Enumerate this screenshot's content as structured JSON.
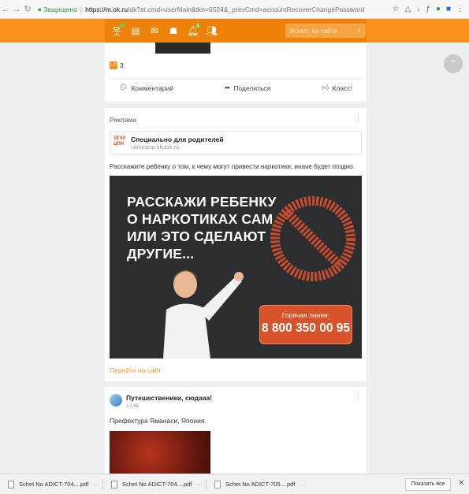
{
  "browser": {
    "secure_label": "Защищено",
    "url_host": "https://m.ok.ru",
    "url_rest": "/dk?st.cmd=userMain&tkn=6524&_prevCmd=accountRecoverChangePassword"
  },
  "header": {
    "icons": [
      "friends-notify-icon",
      "feed-icon",
      "messages-icon",
      "discussions-icon",
      "notifications-icon",
      "friends-icon"
    ],
    "notifications_count": "1",
    "search_placeholder": "Искать на сайте"
  },
  "post_top": {
    "likes_count": "3",
    "comment_label": "Комментарий",
    "share_label": "Поделиться",
    "like_label": "Класс!"
  },
  "ad": {
    "label": "Реклама",
    "advertiser_logo_text": "ОГКУ ЦПН",
    "advertiser_name": "Специально для родителей",
    "advertiser_site": "narkostop.irkutsk.ru",
    "text": "Расскажите ребенку о том, к чему могут привести наркотики, иначе будет поздно.",
    "headline_lines": [
      "РАССКАЖИ РЕБЕНКУ",
      "О НАРКОТИКАХ САМ",
      "ИЛИ ЭТО СДЕЛАЮТ",
      "ДРУГИЕ..."
    ],
    "hotline_label": "Горячая линия:",
    "hotline_number": "8 800 350 00 95",
    "link_label": "Перейти на сайт"
  },
  "post_bottom": {
    "group_name": "Путешественики, сюдааа!",
    "time": "13:45",
    "text": "Префектура Яманаси, Япония."
  },
  "downloads": {
    "items": [
      "Schet No ADICT-704....pdf",
      "Schet No ADICT-704....pdf",
      "Schet No ADICT-705....pdf"
    ],
    "show_all_label": "Показать все"
  },
  "colors": {
    "brand_orange": "#f7931e",
    "hotline_red": "#d8532a"
  }
}
